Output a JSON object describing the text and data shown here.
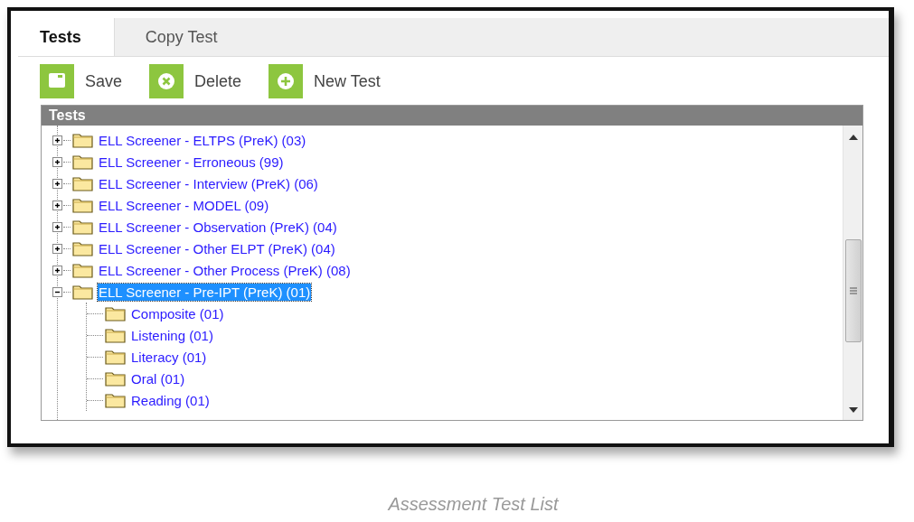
{
  "tabs": [
    {
      "label": "Tests",
      "selected": true
    },
    {
      "label": "Copy Test",
      "selected": false
    }
  ],
  "toolbar": [
    {
      "kind": "save",
      "label": "Save"
    },
    {
      "kind": "delete",
      "label": "Delete"
    },
    {
      "kind": "new",
      "label": "New Test"
    }
  ],
  "tree": {
    "title": "Tests",
    "items": [
      {
        "label": "ELL Screener - ELTPS (PreK) (03)",
        "expanded": false,
        "selected": false
      },
      {
        "label": "ELL Screener - Erroneous (99)",
        "expanded": false,
        "selected": false
      },
      {
        "label": "ELL Screener - Interview (PreK) (06)",
        "expanded": false,
        "selected": false
      },
      {
        "label": "ELL Screener - MODEL (09)",
        "expanded": false,
        "selected": false
      },
      {
        "label": "ELL Screener - Observation (PreK) (04)",
        "expanded": false,
        "selected": false
      },
      {
        "label": "ELL Screener - Other ELPT (PreK) (04)",
        "expanded": false,
        "selected": false
      },
      {
        "label": "ELL Screener - Other Process (PreK) (08)",
        "expanded": false,
        "selected": false
      },
      {
        "label": "ELL Screener - Pre-IPT (PreK) (01)",
        "expanded": true,
        "selected": true,
        "children": [
          {
            "label": "Composite (01)",
            "selected": false
          },
          {
            "label": "Listening (01)",
            "selected": false
          },
          {
            "label": "Literacy (01)",
            "selected": false
          },
          {
            "label": "Oral (01)",
            "selected": false
          },
          {
            "label": "Reading (01)",
            "selected": false
          }
        ]
      }
    ]
  },
  "caption": "Assessment Test List"
}
